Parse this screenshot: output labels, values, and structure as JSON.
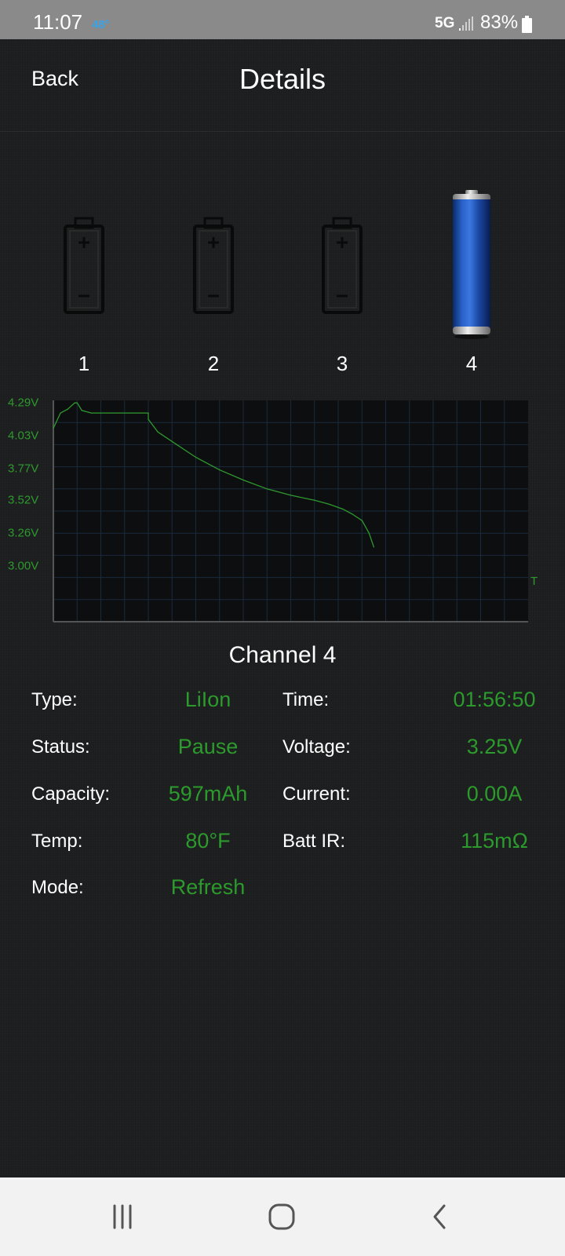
{
  "status_bar": {
    "time": "11:07",
    "temperature": "48°",
    "network": "5G",
    "battery_pct": "83%",
    "icons": [
      "signal-icon",
      "battery-icon"
    ]
  },
  "header": {
    "back_label": "Back",
    "title": "Details"
  },
  "slots": [
    {
      "label": "1",
      "state": "empty"
    },
    {
      "label": "2",
      "state": "empty"
    },
    {
      "label": "3",
      "state": "empty"
    },
    {
      "label": "4",
      "state": "active"
    }
  ],
  "chart_data": {
    "type": "line",
    "title": "",
    "xlabel": "T",
    "ylabel": "",
    "ytick_labels": [
      "4.29V",
      "4.03V",
      "3.77V",
      "3.52V",
      "3.26V",
      "3.00V"
    ],
    "yticks": [
      4.29,
      4.03,
      3.77,
      3.52,
      3.26,
      3.0
    ],
    "ylim": [
      2.55,
      4.3
    ],
    "xlim": [
      0,
      100
    ],
    "grid": true,
    "series": [
      {
        "color": "#2e9a2e",
        "x": [
          0,
          1.5,
          3,
          4.5,
          5,
          6,
          8,
          12,
          20,
          20,
          22,
          26,
          30,
          35,
          40,
          45,
          50,
          55,
          58,
          61,
          63,
          65,
          66.5,
          67.5
        ],
        "y": [
          4.08,
          4.2,
          4.23,
          4.28,
          4.28,
          4.22,
          4.2,
          4.2,
          4.2,
          4.15,
          4.05,
          3.95,
          3.85,
          3.75,
          3.67,
          3.6,
          3.55,
          3.51,
          3.48,
          3.44,
          3.4,
          3.35,
          3.25,
          3.14
        ]
      }
    ]
  },
  "channel": {
    "title": "Channel 4",
    "left": [
      {
        "label": "Type:",
        "value": "LiIon"
      },
      {
        "label": "Status:",
        "value": "Pause"
      },
      {
        "label": "Capacity:",
        "value": "597mAh"
      },
      {
        "label": "Temp:",
        "value": "80°F"
      },
      {
        "label": "Mode:",
        "value": "Refresh"
      }
    ],
    "right": [
      {
        "label": "Time:",
        "value": "01:56:50"
      },
      {
        "label": "Voltage:",
        "value": "3.25V"
      },
      {
        "label": "Current:",
        "value": "0.00A"
      },
      {
        "label": "Batt IR:",
        "value": "115mΩ"
      }
    ]
  },
  "nav_bar": {
    "icons": [
      "recent-apps-icon",
      "home-icon",
      "back-icon"
    ]
  }
}
